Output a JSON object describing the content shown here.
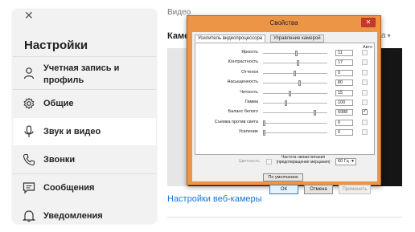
{
  "settings": {
    "title": "Настройки",
    "close_icon": "close-icon",
    "items": [
      {
        "label": "Учетная запись и профиль",
        "icon": "person-icon"
      },
      {
        "label": "Общие",
        "icon": "gear-icon"
      },
      {
        "label": "Звук и видео",
        "icon": "microphone-icon",
        "active": true
      },
      {
        "label": "Звонки",
        "icon": "phone-icon"
      },
      {
        "label": "Сообщения",
        "icon": "chat-icon"
      },
      {
        "label": "Уведомления",
        "icon": "bell-icon"
      }
    ]
  },
  "main": {
    "section_label": "Видео",
    "camera_label": "Камера",
    "combo_fragment": "а",
    "webcam_settings_link": "Настройки веб-камеры"
  },
  "dialog": {
    "title": "Свойства",
    "close_label": "✕",
    "tabs": [
      "Усилитель видеопроцессора",
      "Управление камерой"
    ],
    "auto_label": "Авто",
    "rows": [
      {
        "label": "Яркость",
        "value": "11",
        "slider": 0.52,
        "auto": false
      },
      {
        "label": "Контрастность",
        "value": "17",
        "slider": 0.55,
        "auto": false
      },
      {
        "label": "Оттенок",
        "value": "0",
        "slider": 0.5,
        "auto": false
      },
      {
        "label": "Насыщенность",
        "value": "80",
        "slider": 0.58,
        "auto": false
      },
      {
        "label": "Четкость",
        "value": "15",
        "slider": 0.42,
        "auto": false
      },
      {
        "label": "Гамма",
        "value": "100",
        "slider": 0.35,
        "auto": false
      },
      {
        "label": "Баланс белого",
        "value": "5988",
        "slider": 0.83,
        "auto": true
      },
      {
        "label": "Съемка против света",
        "value": "0",
        "slider": 0.0,
        "auto": false
      },
      {
        "label": "Усиление",
        "value": "0",
        "slider": 0.0,
        "auto": false
      }
    ],
    "color_label": "Цветность",
    "powerline_label": "Частота линии питания (предотвращение мерцания)",
    "powerline_value": "60 Гц",
    "default_button": "По умолчанию",
    "ok_button": "ОК",
    "cancel_button": "Отмена",
    "apply_button": "Применить"
  },
  "colors": {
    "accent_link": "#1976d2",
    "dialog_frame": "#ec9547",
    "close_button": "#c7372c"
  }
}
